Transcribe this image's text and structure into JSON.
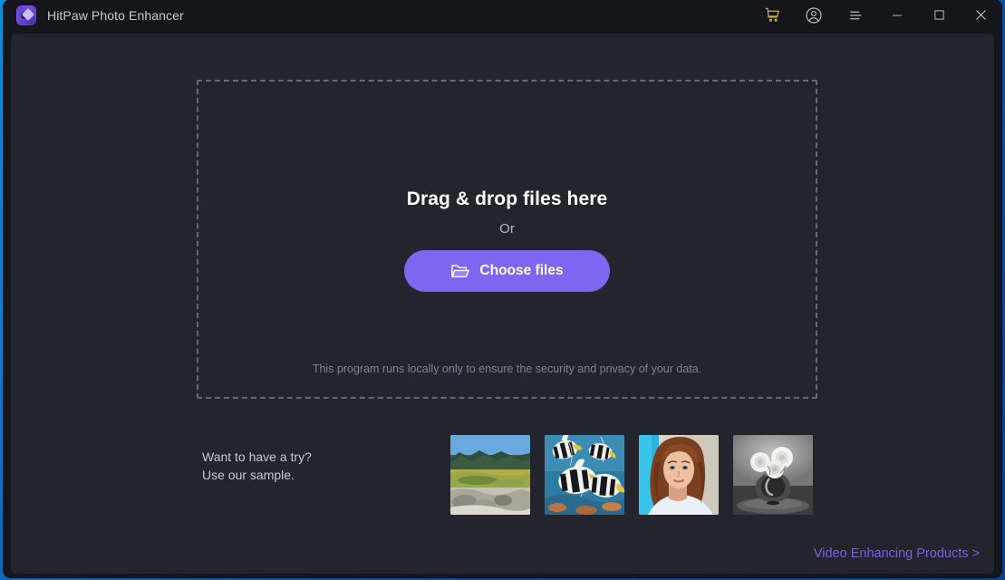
{
  "window": {
    "title": "HitPaw Photo Enhancer",
    "app_icon": "hitpaw-logo-icon",
    "accent_color": "#7f66f0",
    "titlebar_bg": "#15161c",
    "panel_bg": "#23242d"
  },
  "titlebar_actions": [
    {
      "name": "cart-button",
      "icon": "shopping-cart-icon",
      "color": "#d6a53e",
      "tooltip": "Store"
    },
    {
      "name": "account-button",
      "icon": "user-circle-icon",
      "color": "#b9bcc6",
      "tooltip": "Account"
    },
    {
      "name": "menu-button",
      "icon": "hamburger-menu-icon",
      "color": "#b9bcc6",
      "tooltip": "Menu"
    },
    {
      "name": "minimize-button",
      "icon": "minimize-icon",
      "color": "#c6c9d2",
      "tooltip": "Minimize"
    },
    {
      "name": "maximize-button",
      "icon": "maximize-icon",
      "color": "#c6c9d2",
      "tooltip": "Maximize"
    },
    {
      "name": "close-button",
      "icon": "close-icon",
      "color": "#d8dbe2",
      "tooltip": "Close"
    }
  ],
  "dropzone": {
    "title": "Drag & drop files here",
    "or_label": "Or",
    "choose_files_label": "Choose files",
    "choose_files_icon": "folder-open-icon",
    "privacy_note": "This program runs locally only to ensure the security and privacy of your data.",
    "border_color": "#646878",
    "button_color": "#7f66f0"
  },
  "samples": {
    "prompt": "Want to have a try?\nUse our sample.",
    "thumbnails": [
      {
        "name": "sample-thumb-landscape",
        "alt": "Mountain meadow with pine trees and rocks"
      },
      {
        "name": "sample-thumb-fish",
        "alt": "Striped tropical moorish idol fish underwater"
      },
      {
        "name": "sample-thumb-portrait",
        "alt": "Portrait of a woman with auburn hair"
      },
      {
        "name": "sample-thumb-roses",
        "alt": "Black and white white roses in a silver vase"
      }
    ]
  },
  "footer": {
    "video_products_label": "Video Enhancing Products >",
    "link_color": "#7b5fe3"
  }
}
